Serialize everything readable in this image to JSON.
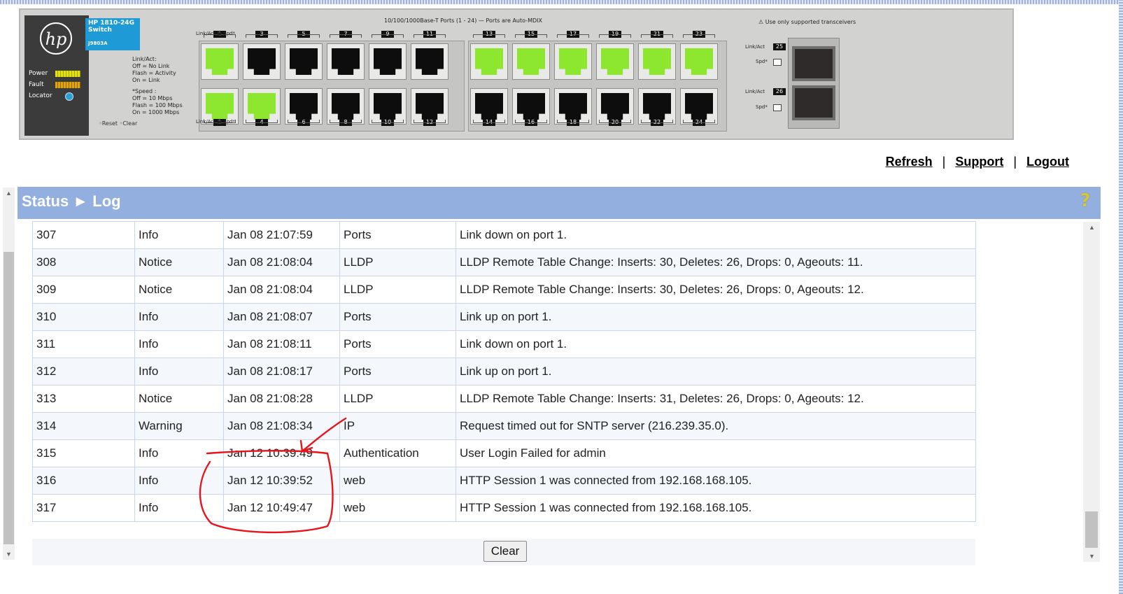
{
  "device": {
    "logo_text": "hp",
    "model_name": "HP 1810-24G Switch",
    "part_number": "J9803A",
    "status_leds": [
      {
        "label": "Power",
        "color": "#e6e400"
      },
      {
        "label": "Fault",
        "color": "#e3a600"
      },
      {
        "label": "Locator",
        "color": "#2aa0d4"
      }
    ],
    "legend_lines": [
      "Link/Act:",
      "Off = No Link",
      "Flash = Activity",
      "On = Link",
      "*Speed :",
      "Off = 10 Mbps",
      "Flash = 100 Mbps",
      "On = 1000 Mbps"
    ],
    "reset_label": "Reset",
    "clear_label": "Clear",
    "ports_title": "10/100/1000Base-T Ports (1 - 24) — Ports are Auto-MDIX",
    "transceiver_warning": "Use only supported transceivers",
    "link_act_label": "Link/Act",
    "spd_label": "Spd*",
    "top_port_numbers": [
      "1",
      "3",
      "5",
      "7",
      "9",
      "11",
      "13",
      "15",
      "17",
      "19",
      "21",
      "23"
    ],
    "bottom_port_numbers": [
      "2",
      "4",
      "6",
      "8",
      "10",
      "12",
      "14",
      "16",
      "18",
      "20",
      "22",
      "24"
    ],
    "sfp_port_numbers": [
      "25",
      "26"
    ],
    "ports_link_up": [
      1,
      2,
      4,
      13,
      15,
      17,
      19,
      21,
      23
    ],
    "link_up_color": "#8ee72f"
  },
  "top_links": {
    "refresh": "Refresh",
    "support": "Support",
    "logout": "Logout",
    "separator": "|"
  },
  "breadcrumb": {
    "section": "Status",
    "arrow": "►",
    "page": "Log",
    "help_icon": "?"
  },
  "log": {
    "rows": [
      {
        "id": "307",
        "severity": "Info",
        "time": "Jan 08 21:07:59",
        "component": "Ports",
        "description": "Link down on port 1."
      },
      {
        "id": "308",
        "severity": "Notice",
        "time": "Jan 08 21:08:04",
        "component": "LLDP",
        "description": "LLDP Remote Table Change: Inserts: 30, Deletes: 26, Drops: 0, Ageouts: 11."
      },
      {
        "id": "309",
        "severity": "Notice",
        "time": "Jan 08 21:08:04",
        "component": "LLDP",
        "description": "LLDP Remote Table Change: Inserts: 30, Deletes: 26, Drops: 0, Ageouts: 12."
      },
      {
        "id": "310",
        "severity": "Info",
        "time": "Jan 08 21:08:07",
        "component": "Ports",
        "description": "Link up on port 1."
      },
      {
        "id": "311",
        "severity": "Info",
        "time": "Jan 08 21:08:11",
        "component": "Ports",
        "description": "Link down on port 1."
      },
      {
        "id": "312",
        "severity": "Info",
        "time": "Jan 08 21:08:17",
        "component": "Ports",
        "description": "Link up on port 1."
      },
      {
        "id": "313",
        "severity": "Notice",
        "time": "Jan 08 21:08:28",
        "component": "LLDP",
        "description": "LLDP Remote Table Change: Inserts: 31, Deletes: 26, Drops: 0, Ageouts: 12."
      },
      {
        "id": "314",
        "severity": "Warning",
        "time": "Jan 08 21:08:34",
        "component": "IP",
        "description": "Request timed out for SNTP server (216.239.35.0)."
      },
      {
        "id": "315",
        "severity": "Info",
        "time": "Jan 12 10:39:49",
        "component": "Authentication",
        "description": "User Login Failed for admin"
      },
      {
        "id": "316",
        "severity": "Info",
        "time": "Jan 12 10:39:52",
        "component": "web",
        "description": "HTTP Session 1 was connected from 192.168.168.105."
      },
      {
        "id": "317",
        "severity": "Info",
        "time": "Jan 12 10:49:47",
        "component": "web",
        "description": "HTTP Session 1 was connected from 192.168.168.105."
      }
    ],
    "clear_button": "Clear"
  },
  "annotation_color": "#e8141c"
}
